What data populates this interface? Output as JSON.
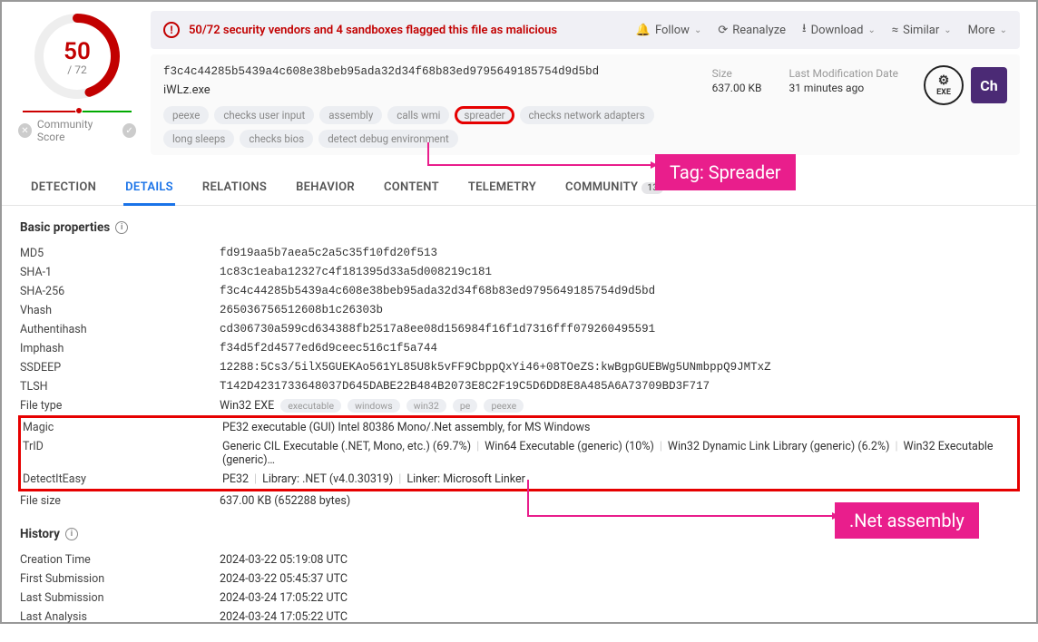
{
  "score": {
    "num": "50",
    "den": "/ 72",
    "community_label": "Community Score"
  },
  "alert": {
    "text": "50/72 security vendors and 4 sandboxes flagged this file as malicious"
  },
  "actions": {
    "follow": "Follow",
    "reanalyze": "Reanalyze",
    "download": "Download",
    "similar": "Similar",
    "more": "More"
  },
  "meta": {
    "hash": "f3c4c44285b5439a4c608e38beb95ada32d34f68b83ed9795649185754d9d5bd",
    "filename": "iWLz.exe",
    "size_label": "Size",
    "size_val": "637.00 KB",
    "mod_label": "Last Modification Date",
    "mod_val": "31 minutes ago",
    "exe_badge": "EXE",
    "ch_badge": "Ch"
  },
  "tags": [
    "peexe",
    "checks user input",
    "assembly",
    "calls wmi",
    "spreader",
    "checks network adapters",
    "long sleeps",
    "checks bios",
    "detect debug environment"
  ],
  "tabs": {
    "detection": "DETECTION",
    "details": "DETAILS",
    "relations": "RELATIONS",
    "behavior": "BEHAVIOR",
    "content": "CONTENT",
    "telemetry": "TELEMETRY",
    "community": "COMMUNITY",
    "community_count": "13"
  },
  "sections": {
    "basic": "Basic properties",
    "history": "History"
  },
  "props": {
    "md5_k": "MD5",
    "md5_v": "fd919aa5b7aea5c2a5c35f10fd20f513",
    "sha1_k": "SHA-1",
    "sha1_v": "1c83c1eaba12327c4f181395d33a5d008219c181",
    "sha256_k": "SHA-256",
    "sha256_v": "f3c4c44285b5439a4c608e38beb95ada32d34f68b83ed9795649185754d9d5bd",
    "vhash_k": "Vhash",
    "vhash_v": "265036756512608b1c26303b",
    "auth_k": "Authentihash",
    "auth_v": "cd306730a599cd634388fb2517a8ee08d156984f16f1d7316fff079260495591",
    "imp_k": "Imphash",
    "imp_v": "f34d5f2d4577ed6d9ceec516c1f5a744",
    "ssd_k": "SSDEEP",
    "ssd_v": "12288:5Cs3/5ilX5GUEKAo561YL85U8k5vFF9CbppQxYi46+08TOeZS:kwBgpGUEBWg5UNmbppQ9JMTxZ",
    "tlsh_k": "TLSH",
    "tlsh_v": "T142D4231733648037D645DABE22B484B2073E8C2F19C5D6DD8E8A485A6A73709BD3F717",
    "ft_k": "File type",
    "ft_v": "Win32 EXE",
    "ft_tags": [
      "executable",
      "windows",
      "win32",
      "pe",
      "peexe"
    ],
    "magic_k": "Magic",
    "magic_v": "PE32 executable (GUI) Intel 80386 Mono/.Net assembly, for MS Windows",
    "trid_k": "TrID",
    "trid_v1": "Generic CIL Executable (.NET, Mono, etc.) (69.7%)",
    "trid_v2": "Win64 Executable (generic) (10%)",
    "trid_v3": "Win32 Dynamic Link Library (generic) (6.2%)",
    "trid_v4": "Win32 Executable (generic)…",
    "die_k": "DetectItEasy",
    "die_v1": "PE32",
    "die_v2": "Library: .NET (v4.0.30319)",
    "die_v3": "Linker: Microsoft Linker",
    "fs_k": "File size",
    "fs_v": "637.00 KB (652288 bytes)"
  },
  "history": {
    "ct_k": "Creation Time",
    "ct_v": "2024-03-22 05:19:08 UTC",
    "fs_k": "First Submission",
    "fs_v": "2024-03-22 05:45:37 UTC",
    "ls_k": "Last Submission",
    "ls_v": "2024-03-24 17:05:22 UTC",
    "la_k": "Last Analysis",
    "la_v": "2024-03-24 17:05:22 UTC"
  },
  "annotations": {
    "spreader": "Tag: Spreader",
    "net": ".Net assembly"
  }
}
